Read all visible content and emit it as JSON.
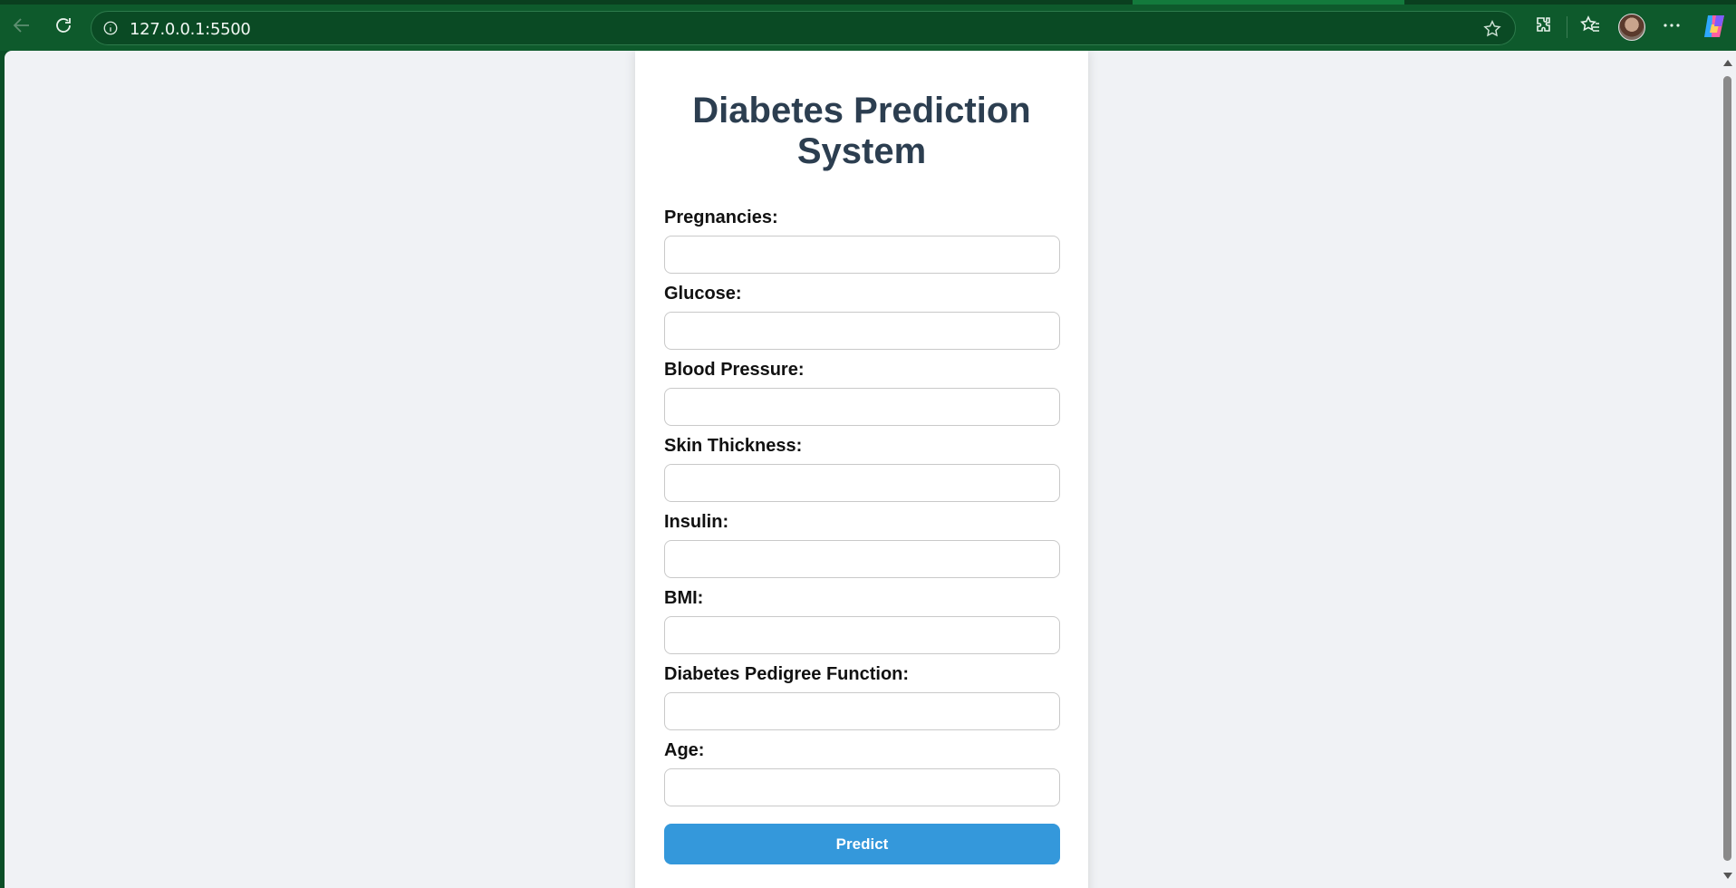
{
  "browser": {
    "url": "127.0.0.1:5500",
    "back_icon": "arrow-left-icon",
    "reload_icon": "reload-icon",
    "info_icon": "info-icon",
    "favorite_icon": "star-icon",
    "extensions_icon": "puzzle-icon",
    "favorites_icon": "favorites-icon",
    "more_icon": "more-icon",
    "copilot_icon": "copilot-icon"
  },
  "page": {
    "title": "Diabetes Prediction System",
    "fields": [
      {
        "label": "Pregnancies:",
        "value": ""
      },
      {
        "label": "Glucose:",
        "value": ""
      },
      {
        "label": "Blood Pressure:",
        "value": ""
      },
      {
        "label": "Skin Thickness:",
        "value": ""
      },
      {
        "label": "Insulin:",
        "value": ""
      },
      {
        "label": "BMI:",
        "value": ""
      },
      {
        "label": "Diabetes Pedigree Function:",
        "value": ""
      },
      {
        "label": "Age:",
        "value": ""
      }
    ],
    "submit_label": "Predict"
  },
  "colors": {
    "browser_frame": "#0e5a2c",
    "page_background": "#f0f2f5",
    "title": "#2c3e50",
    "button": "#3498db"
  }
}
